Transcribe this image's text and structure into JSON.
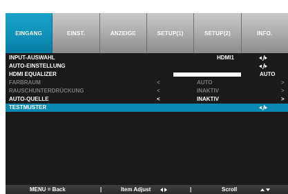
{
  "tabs": [
    {
      "label": "EINGANG",
      "active": true
    },
    {
      "label": "EINST.",
      "active": false
    },
    {
      "label": "ANZEIGE",
      "active": false
    },
    {
      "label": "SETUP(1)",
      "active": false
    },
    {
      "label": "SETUP(2)",
      "active": false
    },
    {
      "label": "INFO.",
      "active": false
    }
  ],
  "rows": [
    {
      "label": "INPUT-AUSWAHL",
      "value": "HDMI1",
      "indicator": "enter-icon"
    },
    {
      "label": "AUTO-EINSTELLUNG",
      "indicator": "enter-icon"
    },
    {
      "label": "HDMI EQUALIZER",
      "value": "AUTO",
      "slider_level": 1.0
    },
    {
      "label": "FARBRAUM",
      "value": "AUTO",
      "disabled": true,
      "left_arrow": "<",
      "right_arrow": ">"
    },
    {
      "label": "RAUSCHUNTERDRÜCKUNG",
      "value": "INAKTIV",
      "disabled": true,
      "left_arrow": "<",
      "right_arrow": ">"
    },
    {
      "label": "AUTO-QUELLE",
      "value": "INAKTIV",
      "left_arrow": "<",
      "right_arrow": ">"
    },
    {
      "label": "TESTMUSTER",
      "indicator": "enter-icon",
      "highlighted": true
    }
  ],
  "footer": {
    "menu_back": "MENU = Back",
    "sep": "|",
    "item_adjust": "Item Adjust",
    "scroll": "Scroll"
  },
  "colors": {
    "accent": "#0b89b3",
    "tab_inactive": "#a9a9a9",
    "background": "#1a1a1a",
    "disabled_text": "#7a7a7a"
  }
}
